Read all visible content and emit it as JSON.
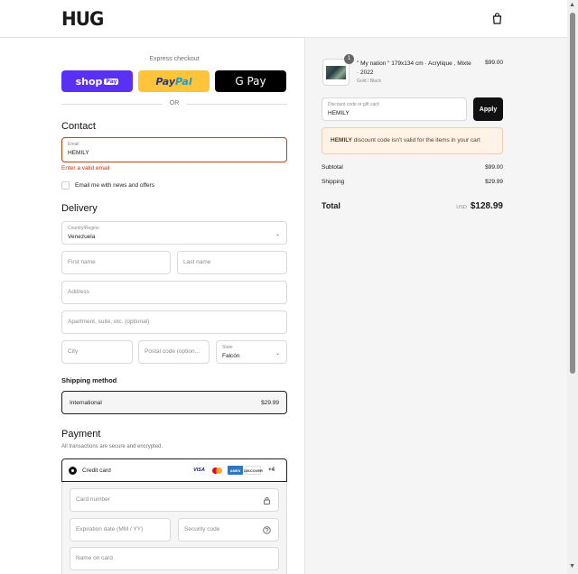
{
  "brand": {
    "logo": "HUG"
  },
  "express": {
    "label": "Express checkout",
    "shop_pay": "shop",
    "shop_pay_badge": "Pay",
    "paypal_a": "Pay",
    "paypal_b": "Pal",
    "gpay": "G Pay",
    "or": "OR"
  },
  "contact": {
    "title": "Contact",
    "email_label": "Email",
    "email_value": "HEMILY",
    "error": "Enter a valid email",
    "newsletter": "Email me with news and offers"
  },
  "delivery": {
    "title": "Delivery",
    "country_label": "Country/Region",
    "country_value": "Venezuela",
    "first_name": "First name",
    "last_name": "Last name",
    "address": "Address",
    "apartment": "Apartment, suite, etc. (optional)",
    "city": "City",
    "postal": "Postal code (option...",
    "state_label": "State",
    "state_value": "Falcón"
  },
  "shipping": {
    "title": "Shipping method",
    "option_name": "International",
    "option_price": "$29.99"
  },
  "payment": {
    "title": "Payment",
    "subtitle": "All transactions are secure and encrypted.",
    "credit_card": "Credit card",
    "card_icons": [
      "VISA",
      "mastercard",
      "AMEX",
      "DISCOVER",
      "+4"
    ],
    "card_number": "Card number",
    "expiration": "Expiration date (MM / YY)",
    "security": "Security code",
    "name_on_card": "Name on card"
  },
  "order": {
    "item_qty": "1",
    "item_name": "\" My nation \" 179x134 cm · Acrylique , Mixte · 2022",
    "item_variant": "Gold / Black",
    "item_price": "$99.00",
    "discount_label": "Discount code or gift card",
    "discount_value": "HEMILY",
    "apply": "Apply",
    "warning_code": "HEMILY",
    "warning_text": " discount code isn't valid for the items in your cart",
    "subtotal_label": "Subtotal",
    "subtotal_value": "$99.00",
    "shipping_label": "Shipping",
    "shipping_value": "$29.99",
    "total_label": "Total",
    "total_currency": "USD",
    "total_value": "$128.99"
  },
  "icons": [
    "bag-icon",
    "chevron-down-icon",
    "lock-icon",
    "help-circle-icon",
    "radio-selected-icon"
  ]
}
